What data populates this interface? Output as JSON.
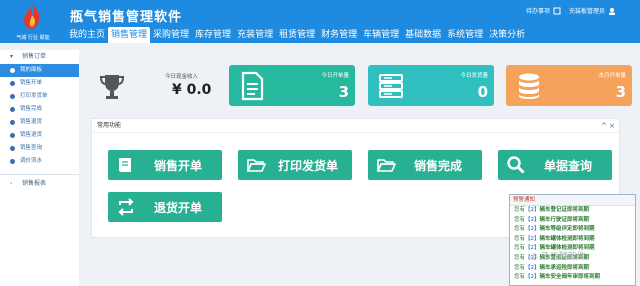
{
  "app": {
    "title": "瓶气销售管理软件",
    "logo_tagline": "气城 行业 赋能"
  },
  "topbar": {
    "todo": "待办事项",
    "user": "充装板管理员"
  },
  "nav": [
    "我的主页",
    "销售管理",
    "采购管理",
    "库存管理",
    "充装管理",
    "租赁管理",
    "财务管理",
    "车辆管理",
    "基础数据",
    "系统管理",
    "决策分析"
  ],
  "sidebar": {
    "group1": "销售订单",
    "items": [
      "我的面板",
      "销售开单",
      "打印发货单",
      "销售完成",
      "销售退货",
      "销售退货",
      "销售查询",
      "调价流水"
    ],
    "group2": "销售报表"
  },
  "stats": {
    "plain_label": "今日现金收入",
    "plain_value": "¥ 0.0",
    "cards": [
      {
        "label": "今日开单量",
        "value": "3",
        "color": "#26b9a0",
        "icon": "document-icon"
      },
      {
        "label": "今日发货量",
        "value": "0",
        "color": "#31c0c0",
        "icon": "server-icon"
      },
      {
        "label": "本月开单量",
        "value": "3",
        "color": "#f5a25a",
        "icon": "database-icon"
      }
    ]
  },
  "panel": {
    "title": "常用功能",
    "tools": "^ ×",
    "buttons": [
      "销售开单",
      "打印发货单",
      "销售完成",
      "单据查询",
      "退货开单"
    ]
  },
  "popup": {
    "title": "预警通知",
    "prefix": "您有",
    "count": "【2】",
    "messages": [
      "辆车登记证即将到期",
      "辆车行驶证即将到期",
      "辆车等级评定即将到期",
      "辆车罐体检测即将到期",
      "辆车罐体检测即将到期",
      "辆车营运证即将到期",
      "辆车承运险即将到期",
      "辆车安全阀年审即将到期"
    ]
  },
  "watermark": "◎ 乙二醇软件"
}
